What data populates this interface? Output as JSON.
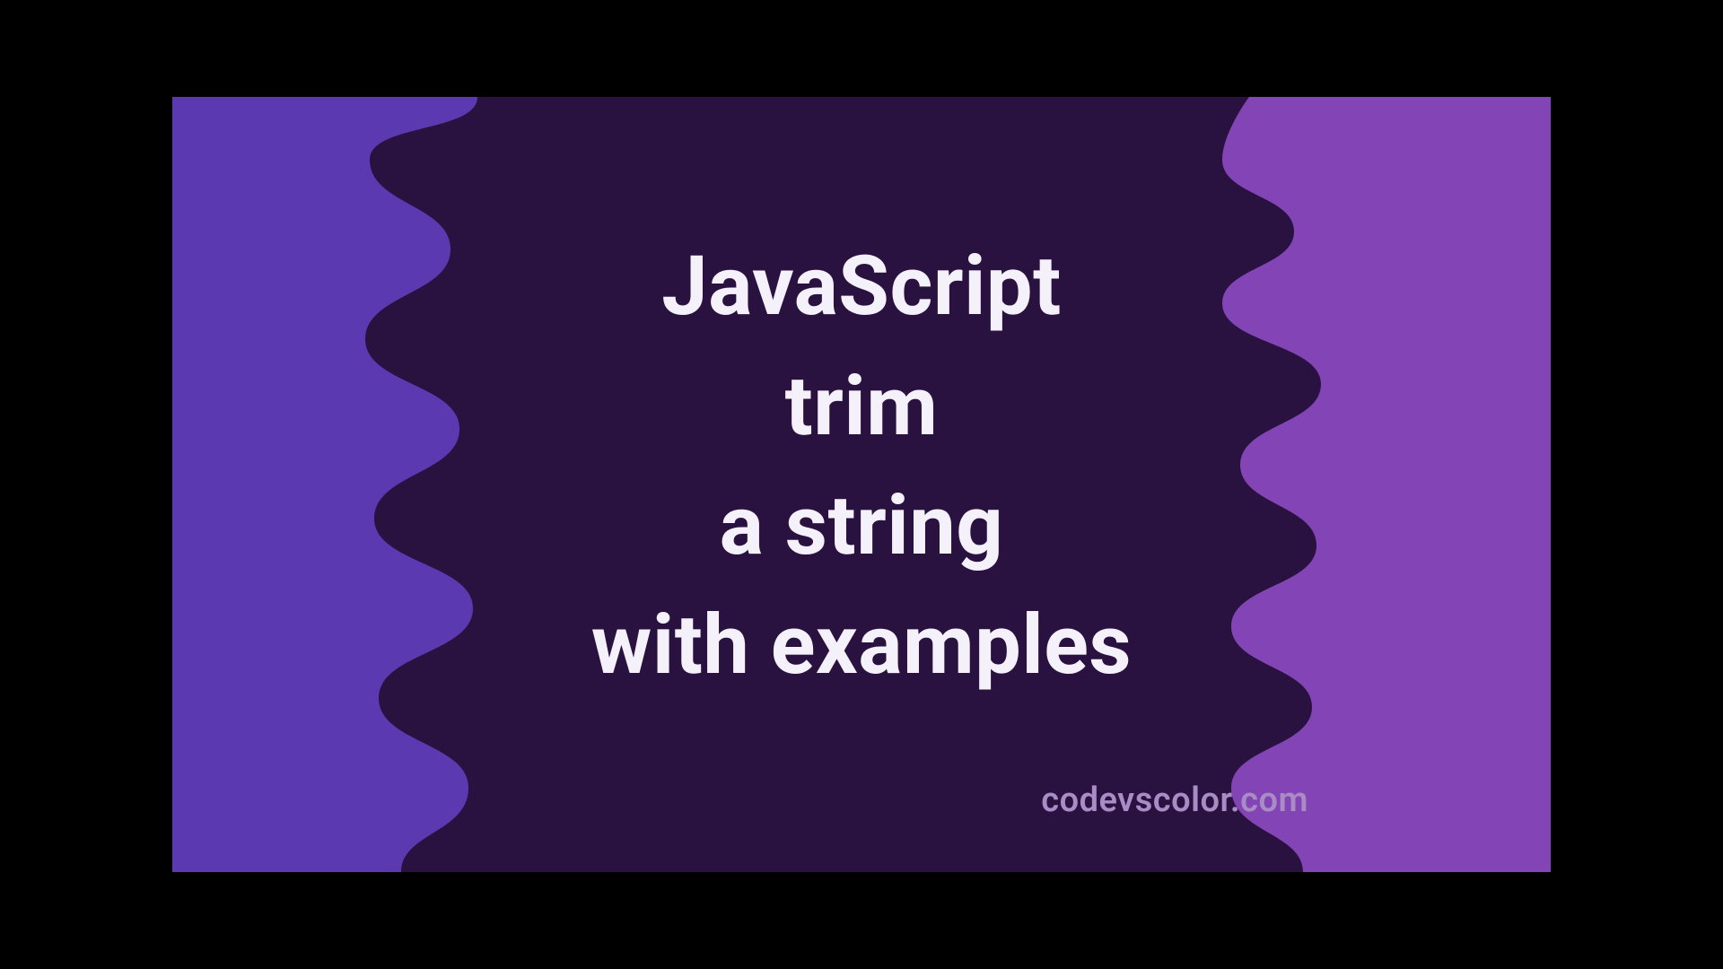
{
  "title": {
    "line1": "JavaScript",
    "line2": "trim",
    "line3": "a string",
    "line4": "with examples"
  },
  "watermark": "codevscolor.com",
  "colors": {
    "bg_left": "#5b39b0",
    "bg_right": "#8344b5",
    "blob": "#2a1240",
    "text": "#f5f1fa",
    "watermark": "#a98cc6"
  }
}
